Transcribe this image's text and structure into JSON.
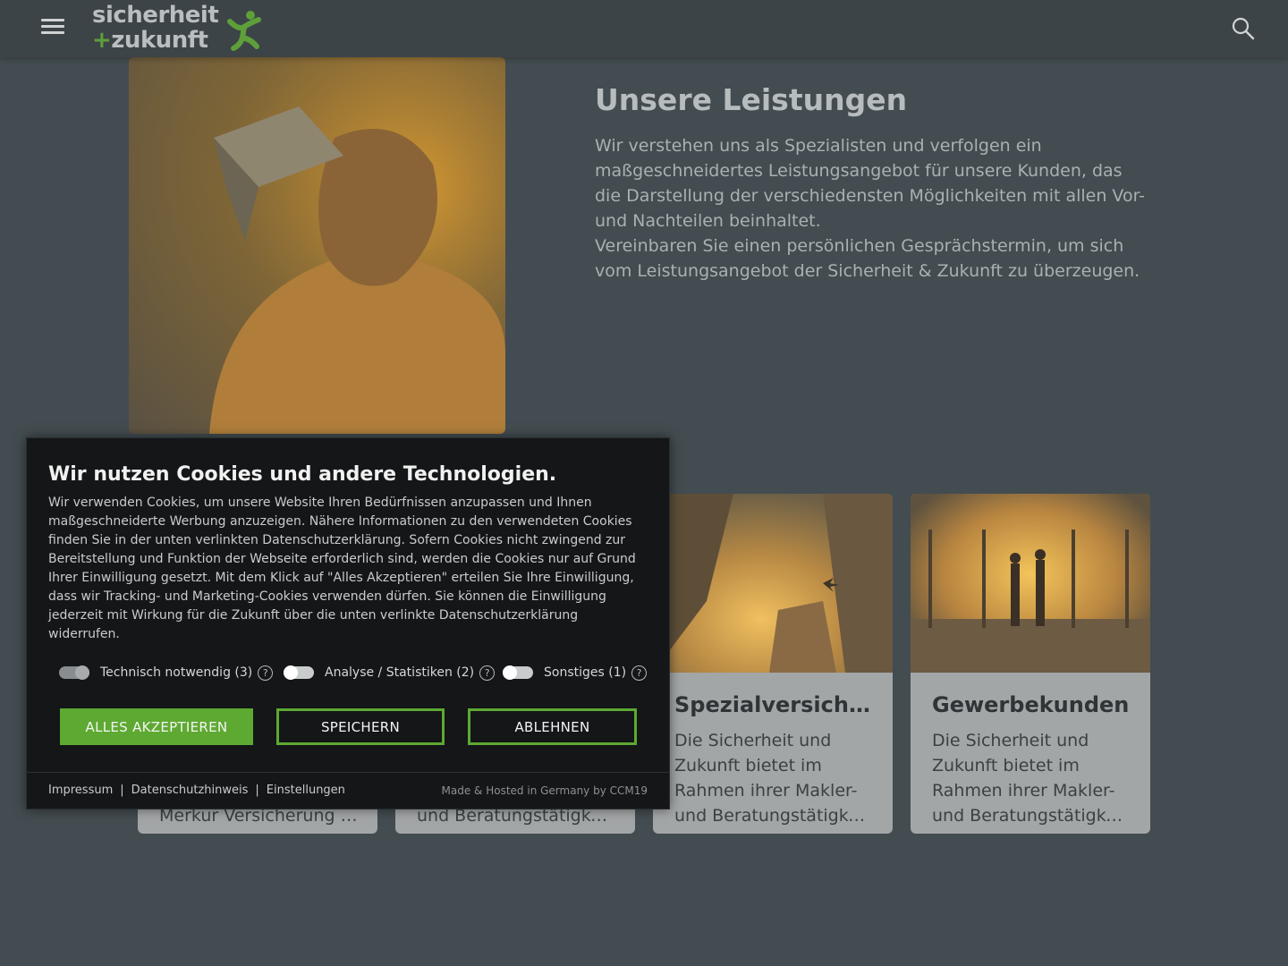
{
  "header": {
    "logo_line1": "sicherheit",
    "logo_plus": "+",
    "logo_line2": "zukunft",
    "menu_icon": "hamburger-icon",
    "search_icon": "search-icon"
  },
  "intro": {
    "title": "Unsere Leistungen",
    "paragraph1": "Wir verstehen uns als Spezialisten und verfolgen ein maßgeschneidertes Leistungsangebot für unsere Kunden, das die Darstellung der verschiedensten Möglichkeiten mit allen Vor- und Nachteilen beinhaltet.",
    "paragraph2": "Vereinbaren Sie einen persönlichen Gesprächstermin, um sich vom Leistungsangebot der Sicherheit & Zukunft zu überzeugen."
  },
  "cards": [
    {
      "title": "",
      "text": "",
      "last_line": "Merkur Versicherung A..."
    },
    {
      "title": "",
      "text": "",
      "last_line": "und Beratungstätigkei..."
    },
    {
      "title": "Spezialversicher...",
      "text": "Die Sicherheit und Zukunft bietet im Rahmen ihrer Makler-",
      "last_line": "und Beratungstätigkei..."
    },
    {
      "title": "Gewerbekunden",
      "text": "Die Sicherheit und Zukunft bietet im Rahmen ihrer Makler-",
      "last_line": "und Beratungstätigkei..."
    }
  ],
  "cookie": {
    "title": "Wir nutzen Cookies und andere Technologien.",
    "text": "Wir verwenden Cookies, um unsere Website Ihren Bedürfnissen anzupassen und Ihnen maßgeschneiderte Werbung anzuzeigen. Nähere Informationen zu den verwendeten Cookies finden Sie in der unten verlinkten Datenschutzerklärung. Sofern Cookies nicht zwingend zur Bereitstellung und Funktion der Webseite erforderlich sind, werden die Cookies nur auf Grund Ihrer Einwilligung gesetzt. Mit dem Klick auf \"Alles Akzeptieren\" erteilen Sie Ihre Einwilligung, dass wir Tracking- und Marketing-Cookies verwenden dürfen. Sie können die Einwilligung jederzeit mit Wirkung für die Zukunft über die unten verlinkte Datenschutzerklärung widerrufen.",
    "toggles": [
      {
        "label": "Technisch notwendig (3)",
        "on": true
      },
      {
        "label": "Analyse / Statistiken (2)",
        "on": false
      },
      {
        "label": "Sonstiges (1)",
        "on": false
      }
    ],
    "help_glyph": "?",
    "accept_label": "ALLES AKZEPTIEREN",
    "save_label": "SPEICHERN",
    "reject_label": "ABLEHNEN",
    "footer_links": [
      "Impressum",
      "Datenschutzhinweis",
      "Einstellungen"
    ],
    "footer_sep": "|",
    "made_by": "Made & Hosted in Germany by CCM19",
    "accent_color": "#5ea932"
  }
}
